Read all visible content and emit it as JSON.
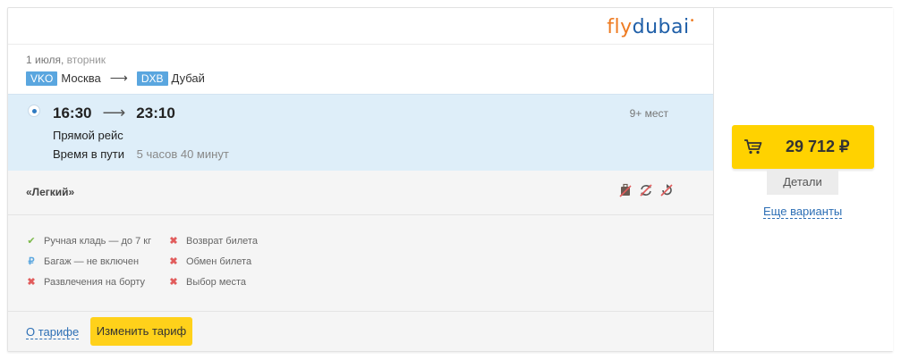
{
  "airline": {
    "logo_fly": "fly",
    "logo_dubai": "dubai"
  },
  "route": {
    "date": "1 июля,",
    "weekday": "вторник",
    "from_code": "VKO",
    "from_city": "Москва",
    "to_code": "DXB",
    "to_city": "Дубай"
  },
  "segment": {
    "depart": "16:30",
    "arrive": "23:10",
    "seats": "9+ мест",
    "direct": "Прямой рейс",
    "duration_label": "Время в пути",
    "duration_value": "5 часов 40 минут"
  },
  "tariff": {
    "name": "«Легкий»",
    "icons": [
      "baggage-crossed-icon",
      "exchange-crossed-icon",
      "refund-crossed-icon"
    ],
    "features_left": [
      {
        "icon": "check-icon",
        "label": "Ручная кладь — до 7 кг"
      },
      {
        "icon": "ruble-icon",
        "label": "Багаж — не включен"
      },
      {
        "icon": "cross-icon",
        "label": "Развлечения на борту"
      }
    ],
    "features_right": [
      {
        "icon": "cross-icon",
        "label": "Возврат билета"
      },
      {
        "icon": "cross-icon",
        "label": "Обмен билета"
      },
      {
        "icon": "cross-icon",
        "label": "Выбор места"
      }
    ],
    "about_link": "О тарифе",
    "change_button": "Изменить тариф"
  },
  "price": {
    "amount": "29 712 ₽",
    "details": "Детали",
    "more": "Еще варианты"
  },
  "colors": {
    "accent_yellow": "#ffd200",
    "link_blue": "#2d6fb5",
    "segment_bg": "#deeef9",
    "iata_bg": "#5aa6df"
  }
}
